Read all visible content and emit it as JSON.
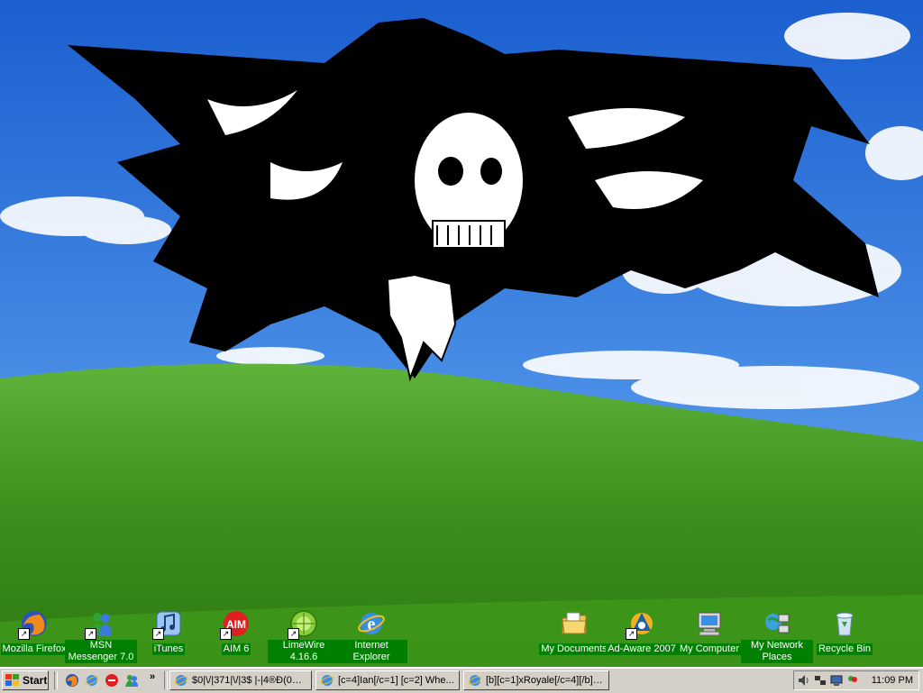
{
  "desktop": {
    "icons": [
      {
        "label": "Mozilla Firefox",
        "icon": "firefox-icon",
        "shortcut": true
      },
      {
        "label": "MSN Messenger 7.0",
        "icon": "msn-messenger-icon",
        "shortcut": true
      },
      {
        "label": "iTunes",
        "icon": "itunes-icon",
        "shortcut": true
      },
      {
        "label": "AIM 6",
        "icon": "aim-icon",
        "shortcut": true
      },
      {
        "label": "LimeWire 4.16.6",
        "icon": "limewire-icon",
        "shortcut": true
      },
      {
        "label": "Internet Explorer",
        "icon": "internet-explorer-icon",
        "shortcut": false
      },
      {
        "label": "My Documents",
        "icon": "my-documents-icon",
        "shortcut": false
      },
      {
        "label": "Ad-Aware 2007",
        "icon": "ad-aware-icon",
        "shortcut": true
      },
      {
        "label": "My Computer",
        "icon": "my-computer-icon",
        "shortcut": false
      },
      {
        "label": "My Network Places",
        "icon": "my-network-places-icon",
        "shortcut": false
      },
      {
        "label": "Recycle Bin",
        "icon": "recycle-bin-icon",
        "shortcut": false
      }
    ],
    "label_color": "#008000"
  },
  "taskbar": {
    "start_label": "Start",
    "quick_launch": [
      "firefox-icon",
      "internet-explorer-icon",
      "aim-icon",
      "msn-messenger-icon"
    ],
    "more_label": "»",
    "tasks": [
      {
        "title": "$0|\\/|371|\\/|3$ |-|4®Ð(0®3...",
        "icon": "internet-explorer-icon"
      },
      {
        "title": "[c=4]Ian[/c=1]  [c=2] Whe...",
        "icon": "internet-explorer-icon"
      },
      {
        "title": "[b][c=1]xRoyale[/c=4][/b] -...",
        "icon": "internet-explorer-icon"
      }
    ],
    "tray_icons": [
      "volume-icon",
      "network-icon",
      "display-icon",
      "msn-tray-icon"
    ],
    "clock": "11:09 PM"
  }
}
